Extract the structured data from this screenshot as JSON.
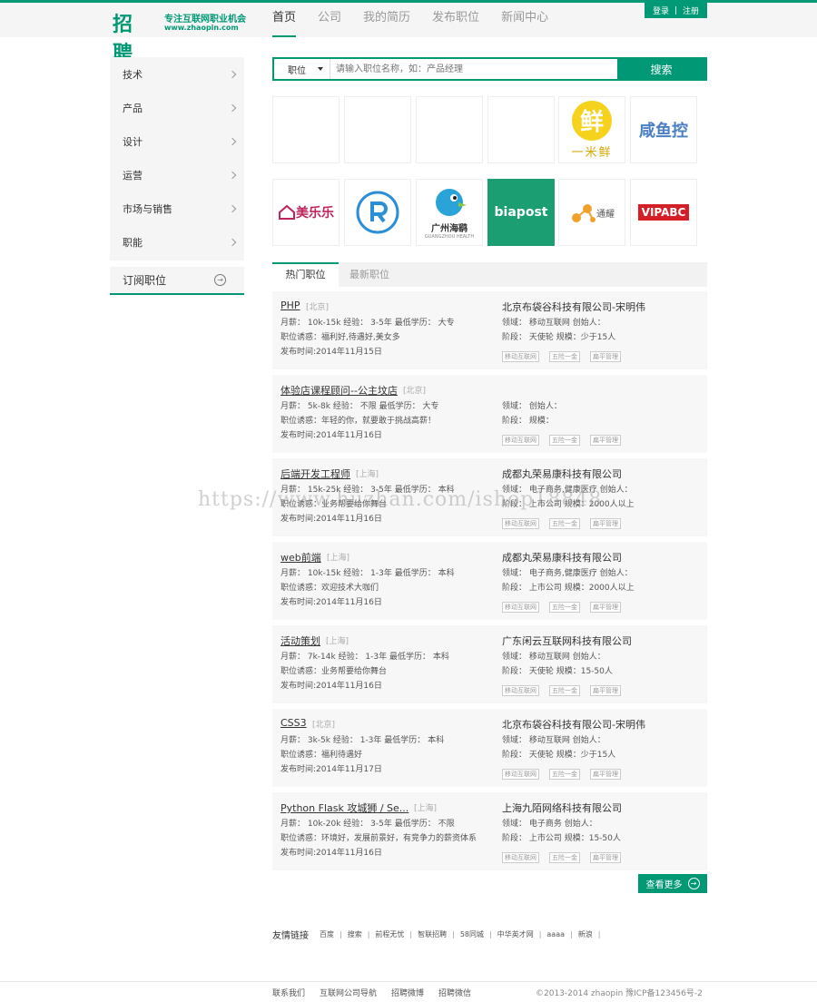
{
  "brand": {
    "logo_text": "招聘",
    "tagline": "专注互联网职业机会",
    "domain": "www.zhaopin.com",
    "accent": "#019875"
  },
  "nav": {
    "items": [
      "首页",
      "公司",
      "我的简历",
      "发布职位",
      "新闻中心"
    ],
    "active": "首页"
  },
  "auth": {
    "login": "登录",
    "divider": "|",
    "register": "注册"
  },
  "sidebar": {
    "items": [
      "技术",
      "产品",
      "设计",
      "运营",
      "市场与销售",
      "职能"
    ],
    "subscribe_label": "订阅职位"
  },
  "search": {
    "category": "职位",
    "placeholder": "请输入职位名称，如：产品经理",
    "button": "搜索"
  },
  "company_logos": {
    "row2": {
      "logo5": "一米鲜",
      "logo5_mark": "鲜",
      "logo6": "咸鱼控"
    },
    "row3": {
      "logo1": "美乐乐",
      "logo3_cn": "广州海鹞",
      "logo3_en": "GUANGZHOU HEALTH",
      "logo4": "biapost",
      "logo5": "通耀",
      "logo6": "VIPABC"
    }
  },
  "tabs": {
    "hot": "热门职位",
    "latest": "最新职位"
  },
  "jobs": [
    {
      "title": "PHP",
      "city": "[北京]",
      "line1": "月薪： 10k-15k   经验： 3-5年   最低学历： 大专",
      "line2": "职位诱惑：福利好,待遇好,美女多",
      "line3": "发布时间:2014年11月15日",
      "company": "北京布袋谷科技有限公司-宋明伟",
      "cline1": "领域： 移动互联网   创始人：",
      "cline2": "阶段： 天使轮   规模：少于15人",
      "tags": [
        "移动互联网",
        "五险一金",
        "扁平管理"
      ]
    },
    {
      "title": "体验店课程顾问--公主坟店",
      "city": "[北京]",
      "line1": "月薪： 5k-8k   经验： 不限   最低学历： 大专",
      "line2": "职位诱惑：年轻的你，就要敢于挑战高薪！",
      "line3": "发布时间:2014年11月16日",
      "company": "",
      "cline1": "领域：   创始人：",
      "cline2": "阶段：   规模：",
      "tags": [
        "移动互联网",
        "五险一金",
        "扁平管理"
      ]
    },
    {
      "title": "后端开发工程师",
      "city": "[上海]",
      "line1": "月薪： 15k-25k   经验： 3-5年   最低学历： 本科",
      "line2": "职位诱惑：业务帮要给你舞台",
      "line3": "发布时间:2014年11月16日",
      "company": "成都丸荣易康科技有限公司",
      "cline1": "领域： 电子商务,健康医疗   创始人：",
      "cline2": "阶段： 上市公司   规模：2000人以上",
      "tags": [
        "移动互联网",
        "五险一金",
        "扁平管理"
      ]
    },
    {
      "title": "web前端",
      "city": "[上海]",
      "line1": "月薪： 10k-15k   经验： 1-3年   最低学历： 本科",
      "line2": "职位诱惑：欢迎技术大咖们",
      "line3": "发布时间:2014年11月16日",
      "company": "成都丸荣易康科技有限公司",
      "cline1": "领域： 电子商务,健康医疗   创始人：",
      "cline2": "阶段： 上市公司   规模：2000人以上",
      "tags": [
        "移动互联网",
        "五险一金",
        "扁平管理"
      ]
    },
    {
      "title": "活动策划",
      "city": "[上海]",
      "line1": "月薪： 7k-14k   经验： 1-3年   最低学历： 本科",
      "line2": "职位诱惑：业务帮要给你舞台",
      "line3": "发布时间:2014年11月16日",
      "company": "广东闲云互联网科技有限公司",
      "cline1": "领域： 移动互联网   创始人：",
      "cline2": "阶段： 天使轮   规模：15-50人",
      "tags": [
        "移动互联网",
        "五险一金",
        "扁平管理"
      ]
    },
    {
      "title": "CSS3",
      "city": "[北京]",
      "line1": "月薪： 3k-5k   经验： 1-3年   最低学历： 本科",
      "line2": "职位诱惑：福利待遇好",
      "line3": "发布时间:2014年11月17日",
      "company": "北京布袋谷科技有限公司-宋明伟",
      "cline1": "领域： 移动互联网   创始人：",
      "cline2": "阶段： 天使轮   规模：少于15人",
      "tags": [
        "移动互联网",
        "五险一金",
        "扁平管理"
      ]
    },
    {
      "title": "Python Flask 攻城狮 / Se...",
      "city": "[上海]",
      "line1": "月薪： 10k-20k   经验： 3-5年   最低学历： 不限",
      "line2": "职位诱惑：环境好，发展前景好，有竞争力的薪资体系",
      "line3": "发布时间:2014年11月16日",
      "company": "上海九陌网络科技有限公司",
      "cline1": "领域： 电子商务   创始人：",
      "cline2": "阶段： 上市公司   规模：15-50人",
      "tags": [
        "移动互联网",
        "五险一金",
        "扁平管理"
      ]
    }
  ],
  "more_button": "查看更多",
  "friend_links": {
    "label": "友情链接",
    "items": [
      "百度",
      "搜索",
      "前程无忧",
      "智联招聘",
      "58同城",
      "中华英才网",
      "aaaa",
      "新浪"
    ]
  },
  "footer": {
    "links": [
      "联系我们",
      "互联网公司导航",
      "招聘微博",
      "招聘微信"
    ],
    "copyright": "©2013-2014 zhaopin   豫ICP备123456号-2"
  },
  "watermark": "https://www.huzhan.com/ishop18848"
}
